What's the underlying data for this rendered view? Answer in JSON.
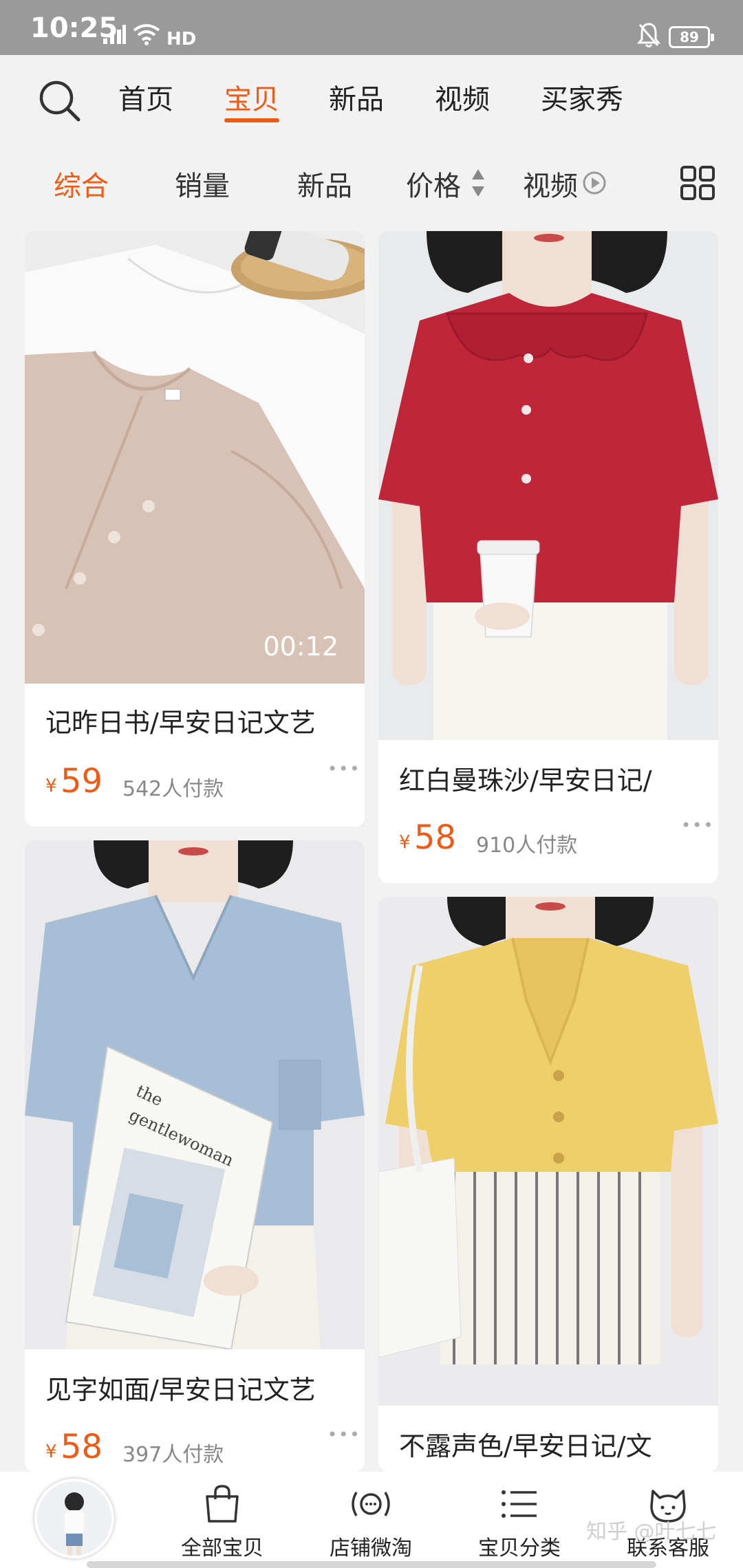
{
  "status_bar": {
    "time": "10:25",
    "network": "4G",
    "hd": "HD",
    "battery": "89"
  },
  "nav": {
    "tabs": [
      {
        "label": "首页",
        "active": false
      },
      {
        "label": "宝贝",
        "active": true
      },
      {
        "label": "新品",
        "active": false
      },
      {
        "label": "视频",
        "active": false
      },
      {
        "label": "买家秀",
        "active": false
      }
    ]
  },
  "sort": {
    "items": [
      {
        "label": "综合",
        "active": true
      },
      {
        "label": "销量",
        "active": false
      },
      {
        "label": "新品",
        "active": false
      },
      {
        "label": "价格",
        "active": false
      },
      {
        "label": "视频",
        "active": false
      }
    ]
  },
  "products": [
    {
      "title": "记昨日书/早安日记文艺",
      "currency": "¥",
      "price": "59",
      "sales": "542人付款",
      "duration": "00:12"
    },
    {
      "title": "红白曼珠沙/早安日记/",
      "currency": "¥",
      "price": "58",
      "sales": "910人付款"
    },
    {
      "title": "见字如面/早安日记文艺",
      "currency": "¥",
      "price": "58",
      "sales": "397人付款"
    },
    {
      "title": "不露声色/早安日记/文",
      "currency": "¥",
      "price": "",
      "sales": ""
    }
  ],
  "bottom_bar": {
    "items": [
      {
        "label": "全部宝贝",
        "icon": "shopping-bag-icon"
      },
      {
        "label": "店铺微淘",
        "icon": "broadcast-icon"
      },
      {
        "label": "宝贝分类",
        "icon": "list-icon"
      },
      {
        "label": "联系客服",
        "icon": "service-cat-icon"
      }
    ]
  },
  "watermark": "知乎 @叶七七",
  "colors": {
    "accent": "#ef5a14",
    "background": "#f2f2f2",
    "card": "#ffffff",
    "muted": "#888888"
  }
}
